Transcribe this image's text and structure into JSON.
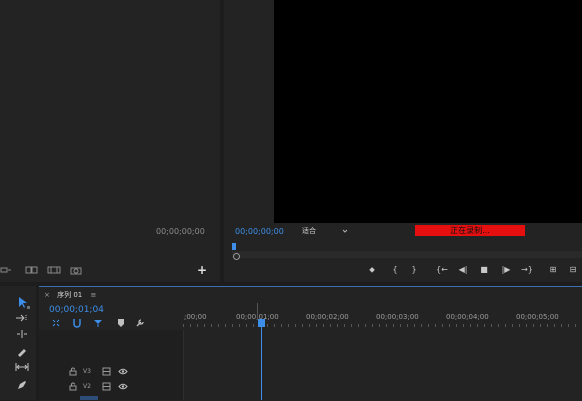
{
  "source_panel": {
    "timecode": "00;00;00;00",
    "add_label": "+",
    "toolbar_icons": [
      "ripple-icon",
      "layer-icon",
      "film-icon",
      "camera-icon"
    ]
  },
  "program_monitor": {
    "timecode": "00;00;00;00",
    "fit_label": "适合",
    "recording_label": "正在录制...",
    "recording_color": "#e60f0f",
    "transport": {
      "marker": "⬥",
      "in": "{",
      "out": "}",
      "goto_in": "{←",
      "step_back": "◀|",
      "stop": "■",
      "step_forward": "|▶",
      "goto_out": "→}",
      "insert": "⊞",
      "overwrite": "⊟"
    }
  },
  "timeline": {
    "tab_close": "×",
    "tab_label": "序列 01",
    "tab_menu": "≡",
    "timecode": "00;00;01;04",
    "ruler": [
      ";00;00",
      "00;00;01;00",
      "00;00;02;00",
      "00;00;03;00",
      "00;00;04;00",
      "00;00;05;00"
    ],
    "tracks": [
      {
        "name": "V3"
      },
      {
        "name": "V2"
      }
    ]
  }
}
